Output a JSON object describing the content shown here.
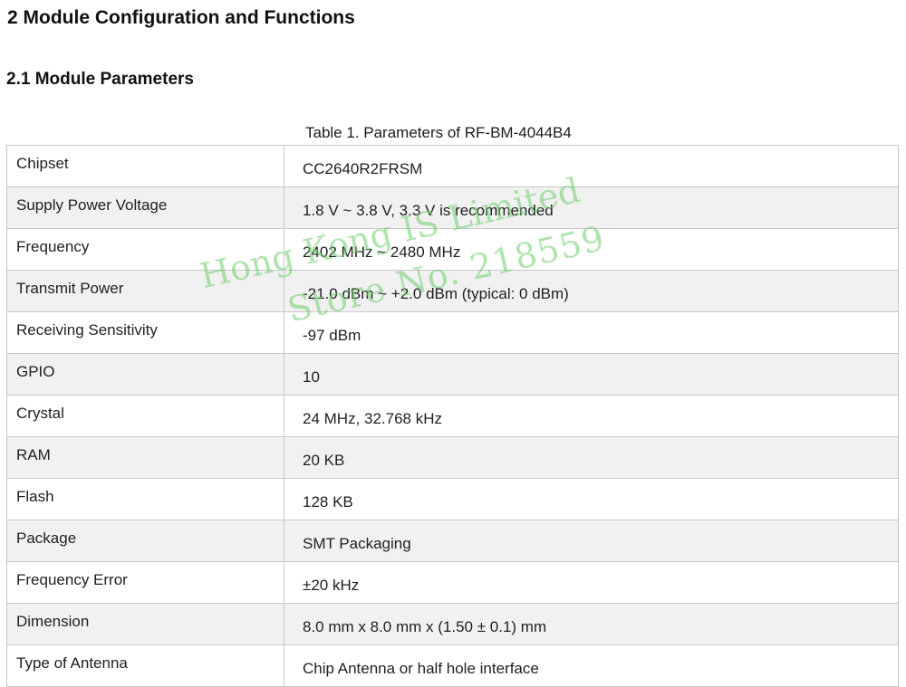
{
  "section": {
    "heading": "2 Module Configuration and Functions",
    "subheading": "2.1 Module Parameters"
  },
  "table": {
    "caption": "Table 1. Parameters of RF-BM-4044B4",
    "rows": [
      {
        "name": "Chipset",
        "value": "CC2640R2FRSM"
      },
      {
        "name": "Supply Power Voltage",
        "value": "1.8 V ~ 3.8 V, 3.3 V is recommended"
      },
      {
        "name": "Frequency",
        "value": "2402 MHz ~ 2480 MHz"
      },
      {
        "name": "Transmit Power",
        "value": "-21.0 dBm ~ +2.0 dBm (typical: 0 dBm)"
      },
      {
        "name": "Receiving Sensitivity",
        "value": "-97 dBm"
      },
      {
        "name": "GPIO",
        "value": "10"
      },
      {
        "name": "Crystal",
        "value": "24 MHz, 32.768 kHz"
      },
      {
        "name": "RAM",
        "value": "20 KB"
      },
      {
        "name": "Flash",
        "value": "128 KB"
      },
      {
        "name": "Package",
        "value": "SMT Packaging"
      },
      {
        "name": "Frequency Error",
        "value": "±20 kHz"
      },
      {
        "name": "Dimension",
        "value": "8.0 mm x 8.0 mm x (1.50 ± 0.1) mm"
      },
      {
        "name": "Type of Antenna",
        "value": "Chip Antenna or half hole interface"
      }
    ]
  },
  "watermark": {
    "line1": "Hong Kong IS Limited",
    "line2": "Store No. 218559"
  }
}
